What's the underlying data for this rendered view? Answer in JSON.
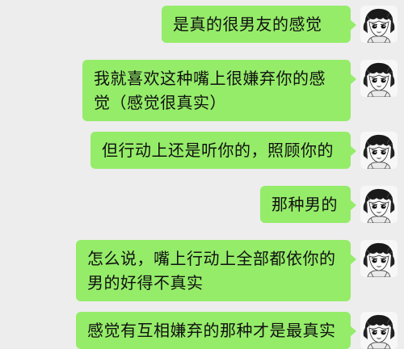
{
  "conversation": {
    "messages": [
      {
        "text": "是真的很男友的感觉",
        "sender": "self"
      },
      {
        "text": "我就喜欢这种嘴上很嫌弃你的感觉（感觉很真实）",
        "sender": "self"
      },
      {
        "text": "但行动上还是听你的，照顾你的",
        "sender": "self"
      },
      {
        "text": "那种男的",
        "sender": "self"
      },
      {
        "text": "怎么说，嘴上行动上全部都依你的男的好得不真实",
        "sender": "self"
      },
      {
        "text": "感觉有互相嫌弃的那种才是最真实",
        "sender": "self"
      }
    ]
  },
  "colors": {
    "background": "#ededed",
    "bubble_self": "#95ec69",
    "text": "#111111"
  },
  "icons": {
    "avatar": "sketch-portrait-avatar"
  }
}
